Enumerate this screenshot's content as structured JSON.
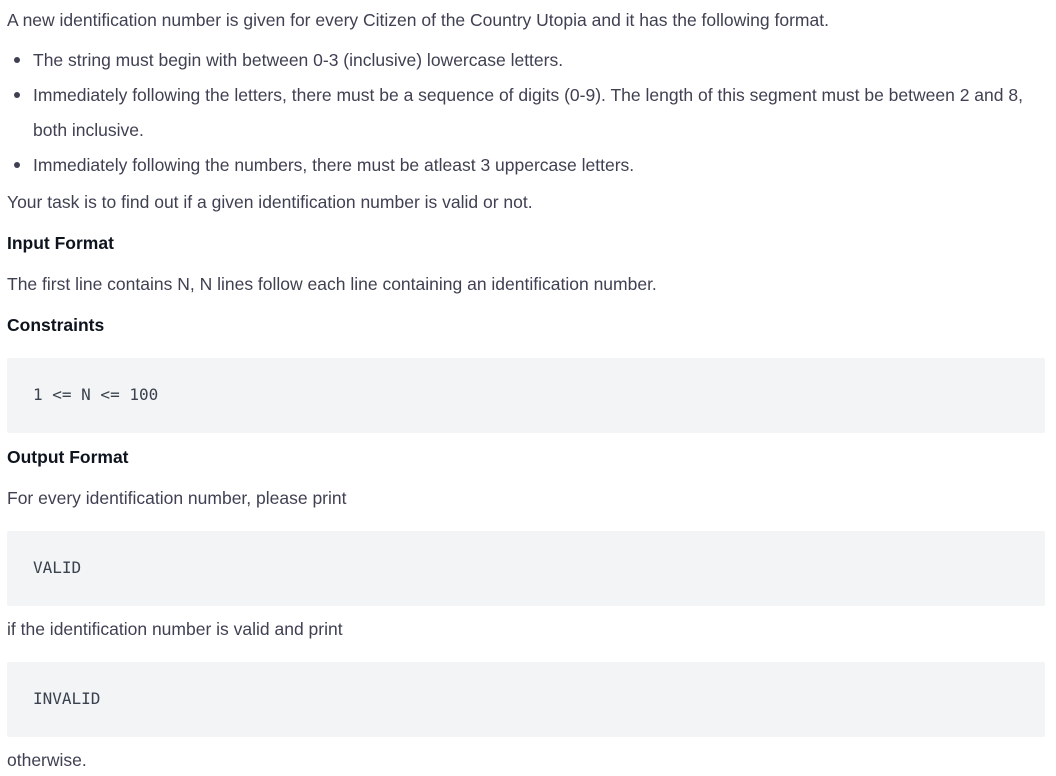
{
  "intro": "A new identification number is given for every Citizen of the Country Utopia and it has the following format.",
  "requirements": [
    "The string must begin with between 0-3 (inclusive) lowercase letters.",
    "Immediately following the letters, there must be a sequence of digits (0-9). The length of this segment must be between 2 and 8, both inclusive.",
    "Immediately following the numbers, there must be atleast 3 uppercase letters."
  ],
  "task": "Your task is to find out if a given identification number is valid or not.",
  "input_format": {
    "heading": "Input Format",
    "text": "The first line contains N, N lines follow each line containing an identification number."
  },
  "constraints": {
    "heading": "Constraints",
    "code": "1 <= N <= 100"
  },
  "output_format": {
    "heading": "Output Format",
    "text1": "For every identification number, please print",
    "code_valid": "VALID",
    "text2": "if the identification number is valid and print",
    "code_invalid": "INVALID",
    "text3": "otherwise."
  }
}
